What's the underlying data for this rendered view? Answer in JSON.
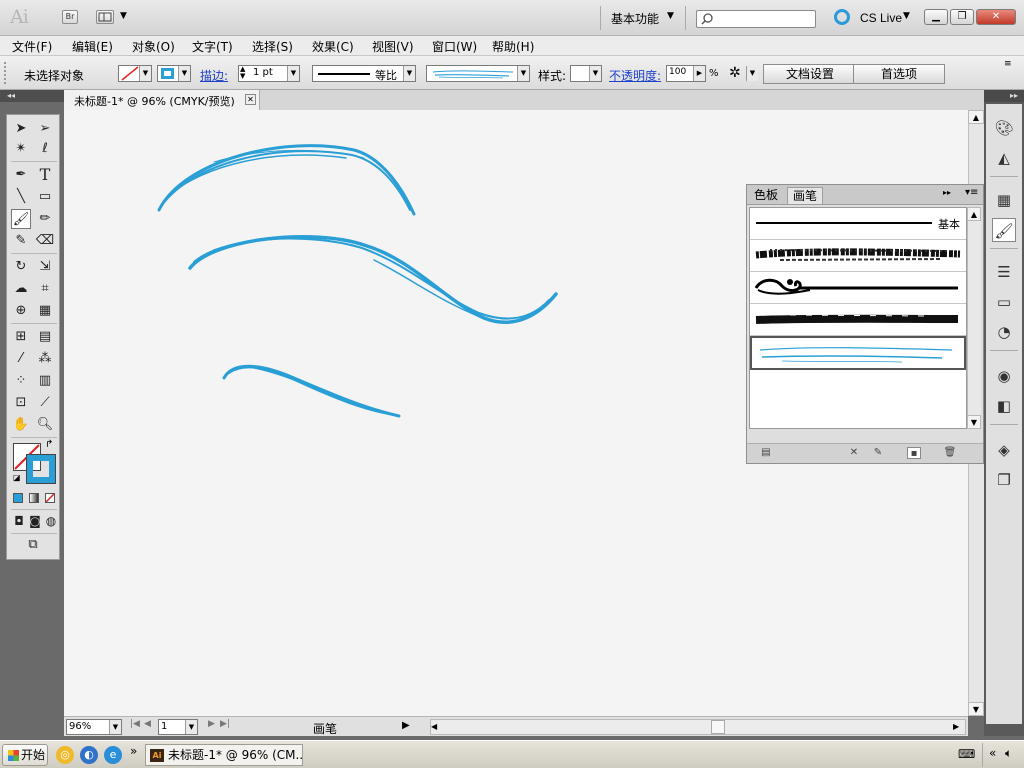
{
  "app": {
    "logo": "Ai",
    "bridge_label": "Br",
    "workspace": "基本功能",
    "cs_live": "CS Live"
  },
  "menu": [
    "文件(F)",
    "编辑(E)",
    "对象(O)",
    "文字(T)",
    "选择(S)",
    "效果(C)",
    "视图(V)",
    "窗口(W)",
    "帮助(H)"
  ],
  "control": {
    "selection_status": "未选择对象",
    "stroke_link": "描边:",
    "stroke_weight": "1 pt",
    "profile": "等比",
    "style_label": "样式:",
    "opacity_link": "不透明度:",
    "opacity_value": "100",
    "opacity_unit": "%",
    "doc_setup": "文档设置",
    "preferences": "首选项"
  },
  "document": {
    "tab_label": "未标题-1* @ 96% (CMYK/预览)"
  },
  "brush_panel": {
    "tabs": [
      "色板",
      "画笔"
    ],
    "active_tab": "画笔",
    "basic_brush_label": "基本"
  },
  "status": {
    "zoom": "96%",
    "page": "1",
    "tool_label": "画笔"
  },
  "taskbar": {
    "start": "开始",
    "task_title": "未标题-1* @ 96% (CM..."
  },
  "colors": {
    "brush_stroke": "#2a9fd6",
    "stroke_swatch": "#2a9fd6",
    "accent_blue": "#1f40c8"
  },
  "icons": {
    "selection": "selection-arrow-icon",
    "direct_selection": "direct-selection-icon",
    "pen": "pen-icon",
    "type": "type-icon",
    "paintbrush": "paintbrush-icon",
    "hand": "hand-icon",
    "zoom": "zoom-icon"
  }
}
